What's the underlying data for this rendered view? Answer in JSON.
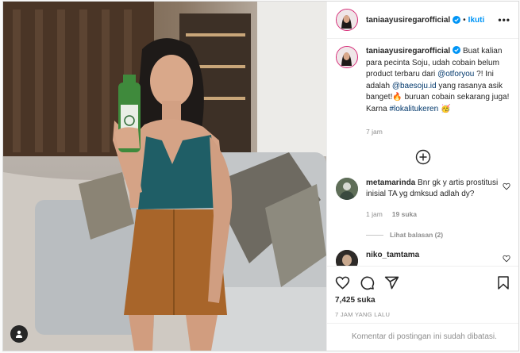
{
  "post": {
    "username": "taniaayusiregarofficial",
    "separator": "•",
    "follow_label": "Ikuti",
    "more_label": "•••",
    "caption": {
      "text_1": "Buat kalian para pecinta Soju, udah cobain belum product terbaru dari ",
      "mention_1": "@otforyou",
      "text_2": " ?! Ini adalah ",
      "mention_2": "@baesoju.id",
      "text_3": " yang rasanya asik banget!🔥 buruan cobain sekarang juga! Karna ",
      "hashtag": "#lokalitukeren",
      "text_4": " 🥳",
      "time": "7 jam"
    },
    "comments": [
      {
        "username": "metamarinda",
        "text": "Bnr gk y artis prostitusi inisial TA yg dmksud adlah dy?",
        "time": "1 jam",
        "likes": "19 suka",
        "replies": "Lihat balasan (2)"
      },
      {
        "username": "niko_tamtama",
        "text": ""
      }
    ],
    "likes_count": "7,425 suka",
    "time_ago": "7 JAM YANG LALU",
    "comments_disabled": "Komentar di postingan ini sudah dibatasi.",
    "colors": {
      "link": "#00376b",
      "follow": "#0095f6",
      "verified": "#0095f6",
      "muted": "#8e8e8e"
    },
    "icons": [
      "user-tag-icon",
      "verified-icon",
      "add-circle-icon",
      "heart-icon",
      "comment-icon",
      "share-icon",
      "bookmark-icon"
    ]
  }
}
